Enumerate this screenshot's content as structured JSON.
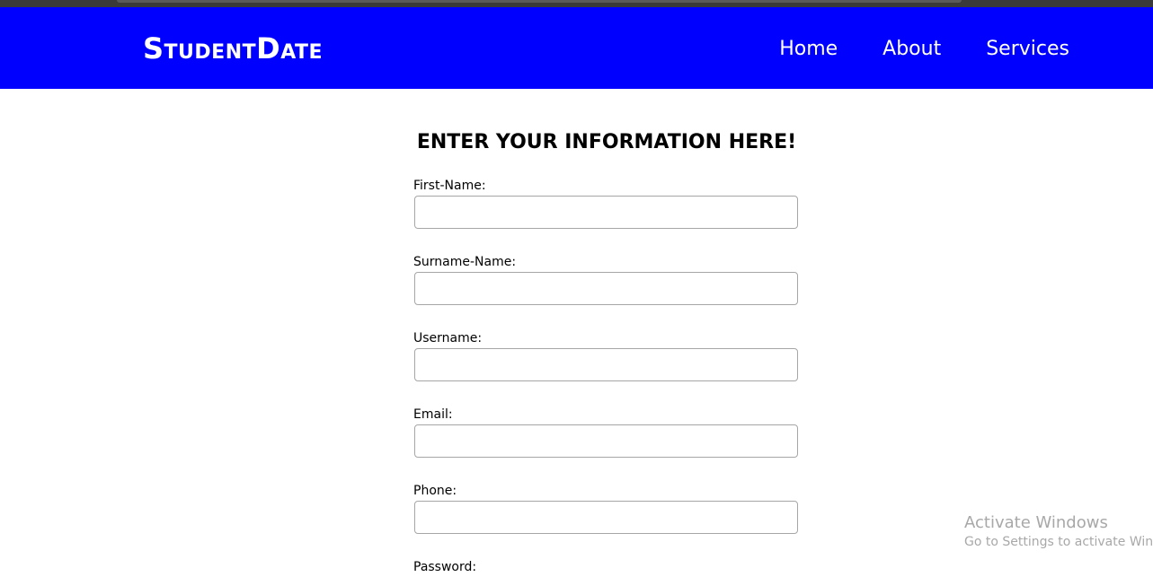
{
  "navbar": {
    "brand": "StudentDate",
    "links": [
      {
        "label": "Home"
      },
      {
        "label": "About"
      },
      {
        "label": "Services"
      }
    ],
    "background_color": "#0000ff"
  },
  "form": {
    "heading": "ENTER YOUR INFORMATION HERE!",
    "fields": [
      {
        "label": "First-Name:",
        "value": ""
      },
      {
        "label": "Surname-Name:",
        "value": ""
      },
      {
        "label": "Username:",
        "value": ""
      },
      {
        "label": "Email:",
        "value": ""
      },
      {
        "label": "Phone:",
        "value": ""
      },
      {
        "label": "Password:",
        "value": ""
      }
    ]
  },
  "watermark": {
    "title": "Activate Windows",
    "subtitle": "Go to Settings to activate Windows."
  }
}
